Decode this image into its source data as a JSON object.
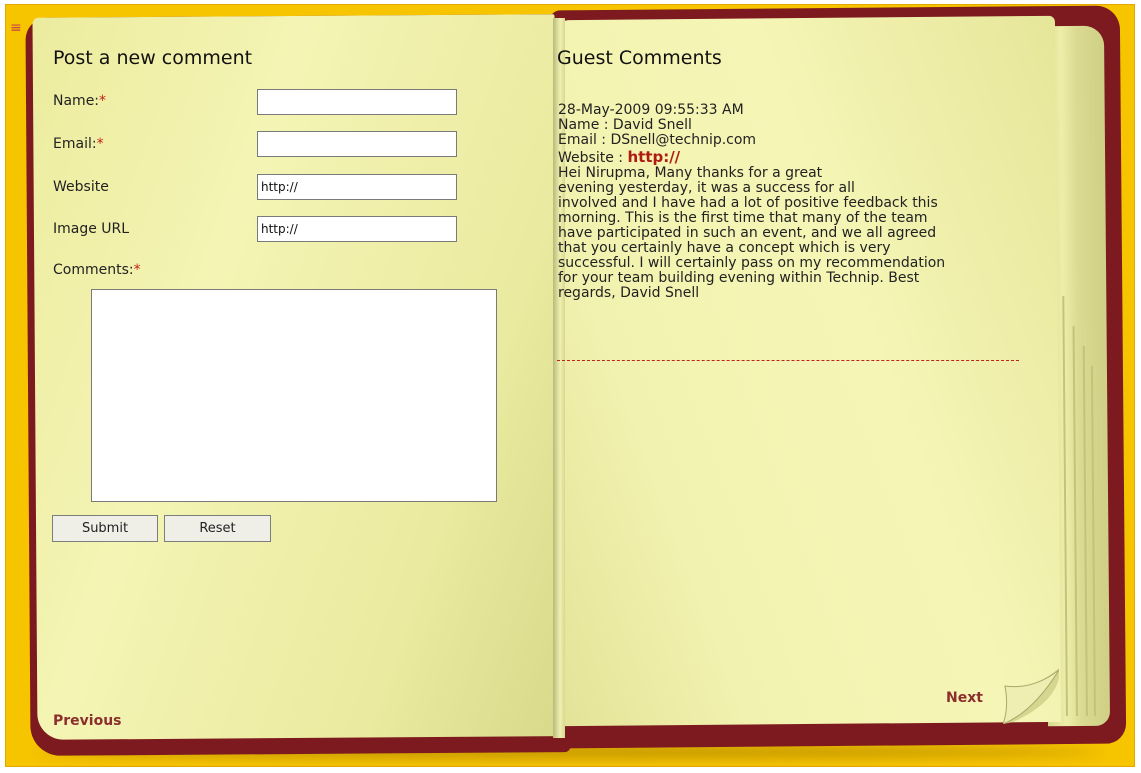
{
  "form": {
    "title": "Post a new comment",
    "name_label": "Name:",
    "email_label": "Email:",
    "website_label": "Website",
    "image_label": "Image URL",
    "comments_label": "Comments:",
    "required_marker": "*",
    "name_value": "",
    "email_value": "",
    "website_value": "http://",
    "image_value": "http://",
    "comments_value": "",
    "submit_label": "Submit",
    "reset_label": "Reset"
  },
  "guest": {
    "title": "Guest Comments",
    "entry": {
      "timestamp": "28-May-2009 09:55:33 AM",
      "name_line": "Name : David Snell",
      "email_line": "Email : DSnell@technip.com",
      "website_label": "Website : ",
      "website_link": "http://",
      "body_lines": [
        "Hei Nirupma, Many thanks for a great",
        "evening yesterday, it was a success for all",
        "involved and I have had a lot of positive feedback this",
        "morning. This is the first time that many of the team",
        "have participated in such an event, and we all agreed",
        "that you certainly have a concept which is very",
        "successful. I will certainly pass on my recommendation",
        "for your team building evening within Technip. Best",
        "regards, David Snell"
      ]
    }
  },
  "nav": {
    "previous_label": "Previous",
    "next_label": "Next"
  },
  "colors": {
    "background": "#f7c400",
    "cover": "#7d1a1f",
    "page": "#f2f2b0",
    "accent_red": "#c0221a",
    "nav_link": "#8b2e2e"
  }
}
